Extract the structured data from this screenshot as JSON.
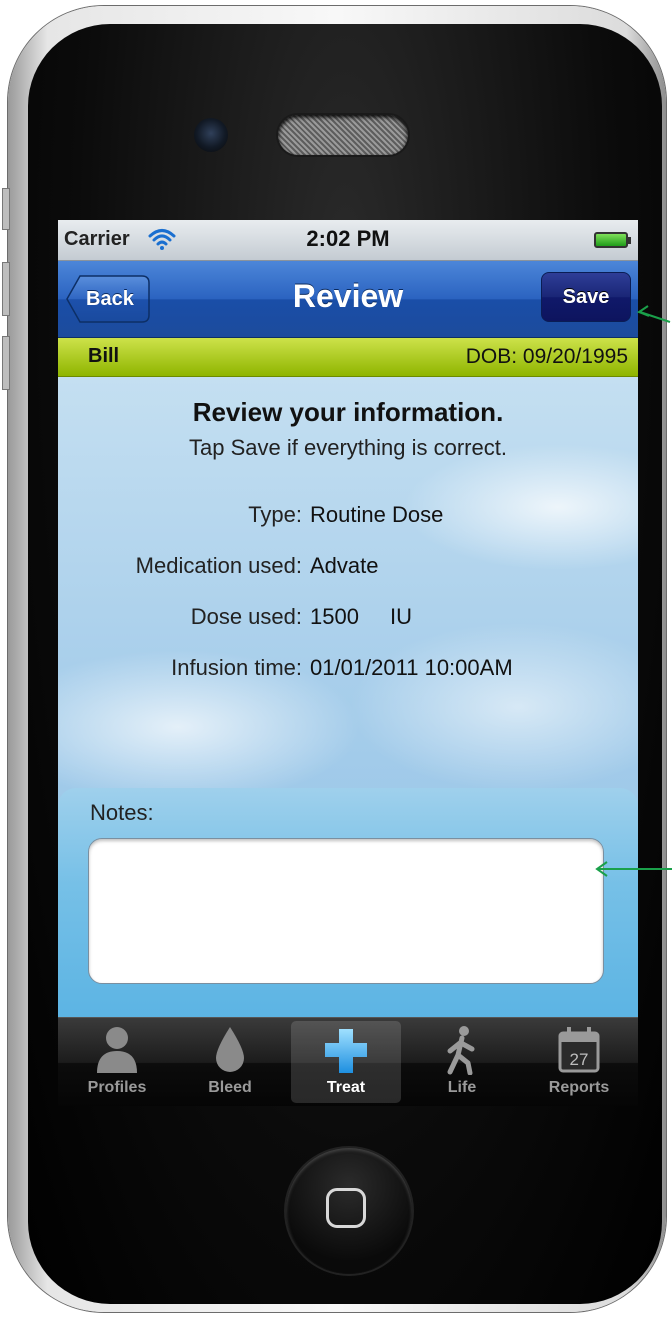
{
  "status_bar": {
    "carrier": "Carrier",
    "time": "2:02 PM"
  },
  "nav_bar": {
    "back_label": "Back",
    "title": "Review",
    "save_label": "Save"
  },
  "patient": {
    "name": "Bill",
    "dob": "DOB: 09/20/1995"
  },
  "review": {
    "heading": "Review your information.",
    "subheading": "Tap Save if everything is correct.",
    "rows": [
      {
        "label": "Type:",
        "value": "Routine Dose"
      },
      {
        "label": "Medication used:",
        "value": "Advate"
      },
      {
        "label": "Dose used:",
        "value": "1500",
        "unit": "IU"
      },
      {
        "label": "Infusion time:",
        "value": "01/01/2011 10:00AM"
      }
    ]
  },
  "notes": {
    "label": "Notes:",
    "value": ""
  },
  "tab_bar": {
    "tabs": [
      {
        "label": "Profiles",
        "icon": "person-icon",
        "active": false
      },
      {
        "label": "Bleed",
        "icon": "drop-icon",
        "active": false
      },
      {
        "label": "Treat",
        "icon": "cross-icon",
        "active": true
      },
      {
        "label": "Life",
        "icon": "walking-person-icon",
        "active": false
      },
      {
        "label": "Reports",
        "icon": "calendar-icon",
        "active": false,
        "icon_text": "27"
      }
    ]
  },
  "colors": {
    "nav_blue": "#2b63c0",
    "save_navy": "#1a2676",
    "patient_green": "#a8c400",
    "annotation_green": "#1aa04a"
  }
}
